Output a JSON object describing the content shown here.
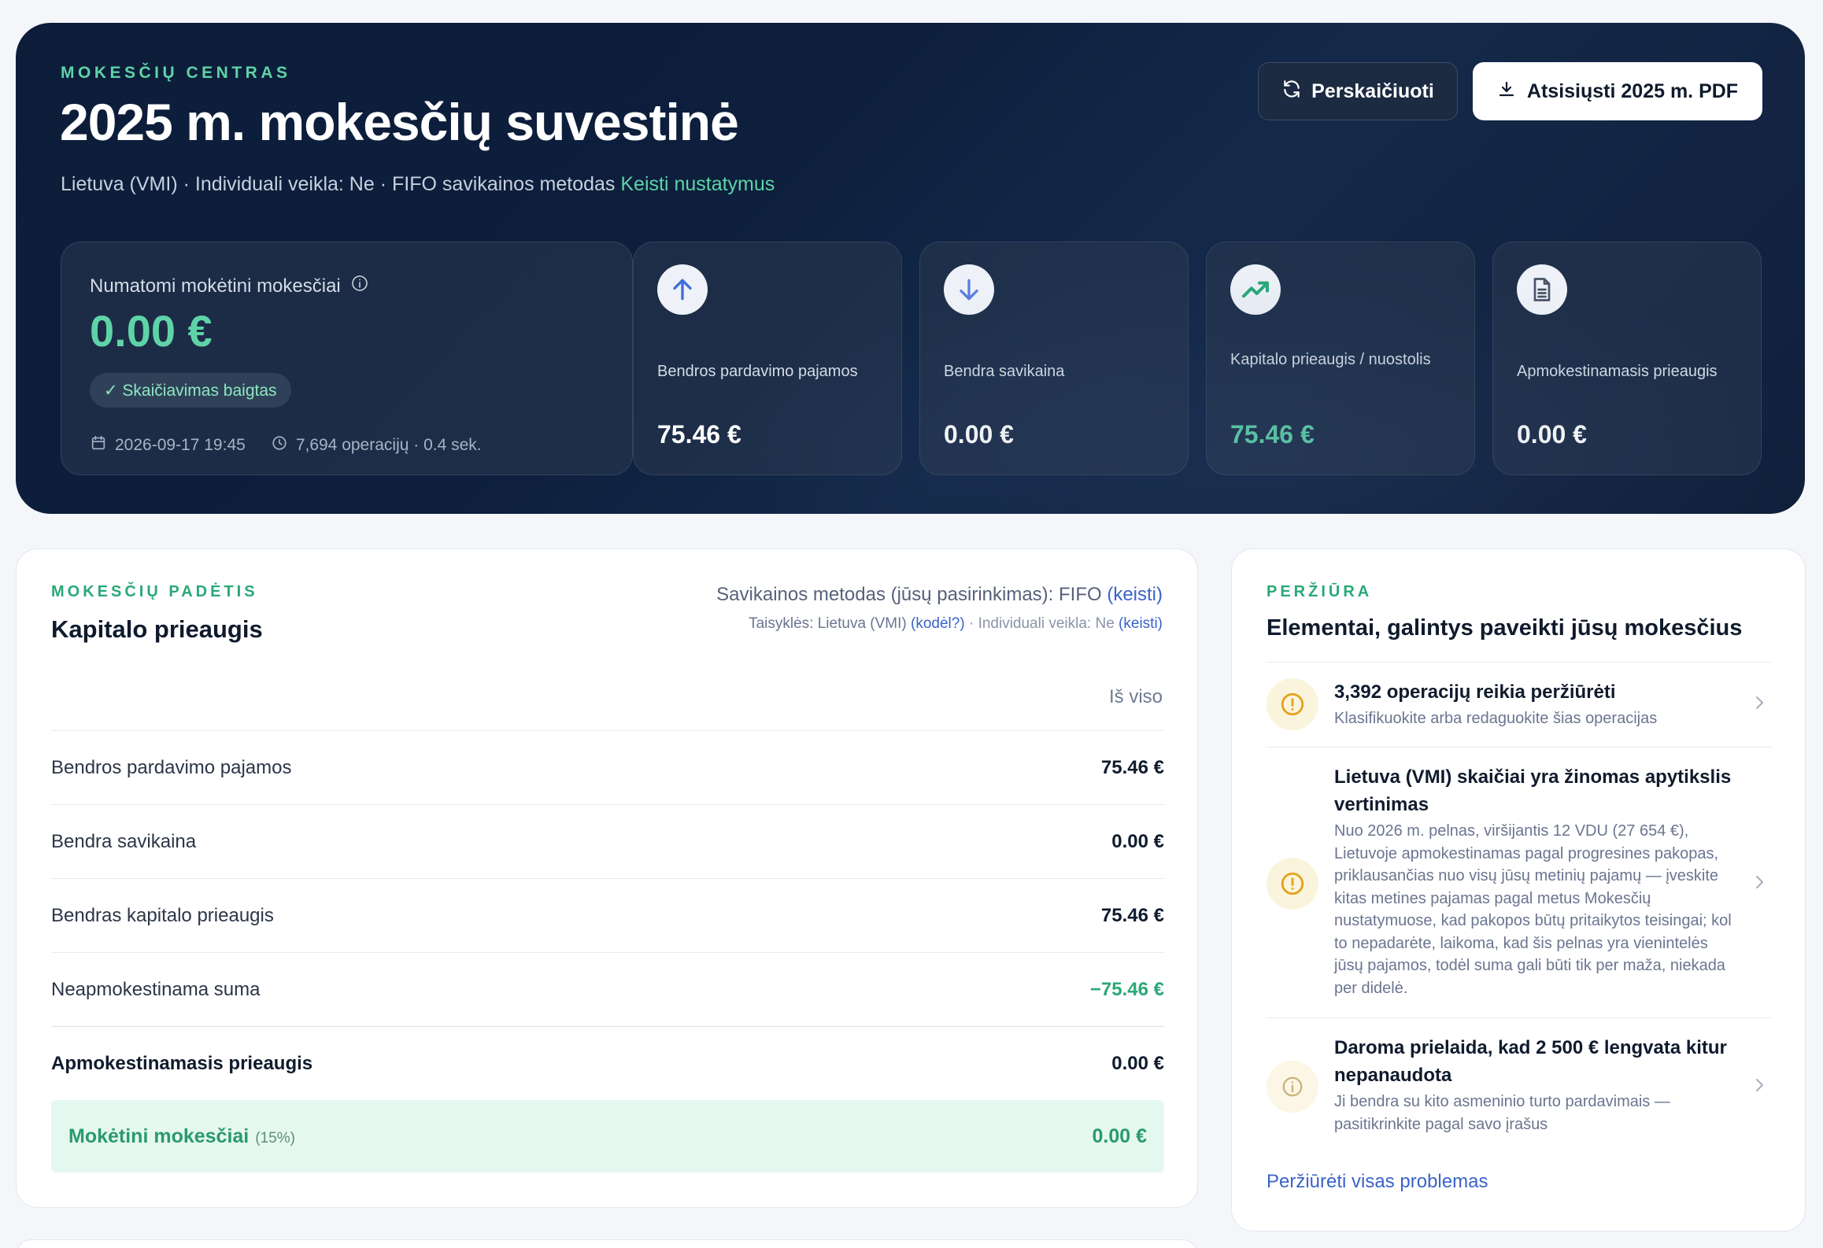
{
  "hero": {
    "eyebrow": "MOKESČIŲ CENTRAS",
    "title": "2025 m. mokesčių suvestinė",
    "subtitle": "Lietuva (VMI) · Individuali veikla: Ne · FIFO savikainos metodas",
    "settings_link": "Keisti nustatymus",
    "recalc_label": "Perskaičiuoti",
    "pdf_label": "Atsisiųsti 2025 m. PDF"
  },
  "summary": {
    "label": "Numatomi mokėtini mokesčiai",
    "value": "0.00 €",
    "badge": "✓ Skaičiavimas baigtas",
    "date": "2026-09-17 19:45",
    "ops": "7,694 operacijų · 0.4 sek."
  },
  "stats": [
    {
      "icon": "arrow-up-icon",
      "label": "Bendros pardavimo pajamos",
      "value": "75.46 €"
    },
    {
      "icon": "arrow-down-icon",
      "label": "Bendra savikaina",
      "value": "0.00 €"
    },
    {
      "icon": "trending-up-icon",
      "label": "Kapitalo prieaugis / nuostolis",
      "value": "75.46 €"
    },
    {
      "icon": "document-icon",
      "label": "Apmokestinamasis prieaugis",
      "value": "0.00 €"
    }
  ],
  "tax": {
    "eyebrow": "MOKESČIŲ PADĖTIS",
    "title": "Kapitalo prieaugis",
    "method_text": "Savikainos metodas (jūsų pasirinkimas): FIFO",
    "method_link": "(keisti)",
    "rules_text": "Taisyklės: Lietuva (VMI)",
    "rules_link": "(kodėl?)",
    "individual_text": "Individuali veikla: Ne",
    "individual_link": "(keisti)",
    "column_header": "Iš viso",
    "rows": [
      {
        "label": "Bendros pardavimo pajamos",
        "value": "75.46 €"
      },
      {
        "label": "Bendra savikaina",
        "value": "0.00 €"
      },
      {
        "label": "Bendras kapitalo prieaugis",
        "value": "75.46 €"
      },
      {
        "label": "Neapmokestinama suma",
        "value": "−75.46 €"
      },
      {
        "label": "Apmokestinamasis prieaugis",
        "value": "0.00 €"
      }
    ],
    "final": {
      "label": "Mokėtini mokesčiai",
      "rate": "(15%)",
      "value": "0.00 €"
    }
  },
  "review": {
    "eyebrow": "PERŽIŪRA",
    "title": "Elementai, galintys paveikti jūsų mokesčius",
    "items": [
      {
        "icon": "warning-icon",
        "title": "3,392 operacijų reikia peržiūrėti",
        "body": "Klasifikuokite arba redaguokite šias operacijas"
      },
      {
        "icon": "warning-icon",
        "title": "Lietuva (VMI) skaičiai yra žinomas apytikslis vertinimas",
        "body": "Nuo 2026 m. pelnas, viršijantis 12 VDU (27 654 €), Lietuvoje apmokestinamas pagal progresines pakopas, priklausančias nuo visų jūsų metinių pajamų — įveskite kitas metines pajamas pagal metus Mokesčių nustatymuose, kad pakopos būtų pritaikytos teisingai; kol to nepadarėte, laikoma, kad šis pelnas yra vienintelės jūsų pajamos, todėl suma gali būti tik per maža, niekada per didelė."
      },
      {
        "icon": "info-icon",
        "title": "Daroma prielaida, kad 2 500 € lengvata kitur nepanaudota",
        "body": "Ji bendra su kito asmeninio turto pardavimais — pasitikrinkite pagal savo įrašus"
      }
    ],
    "link": "Peržiūrėti visas problemas"
  }
}
